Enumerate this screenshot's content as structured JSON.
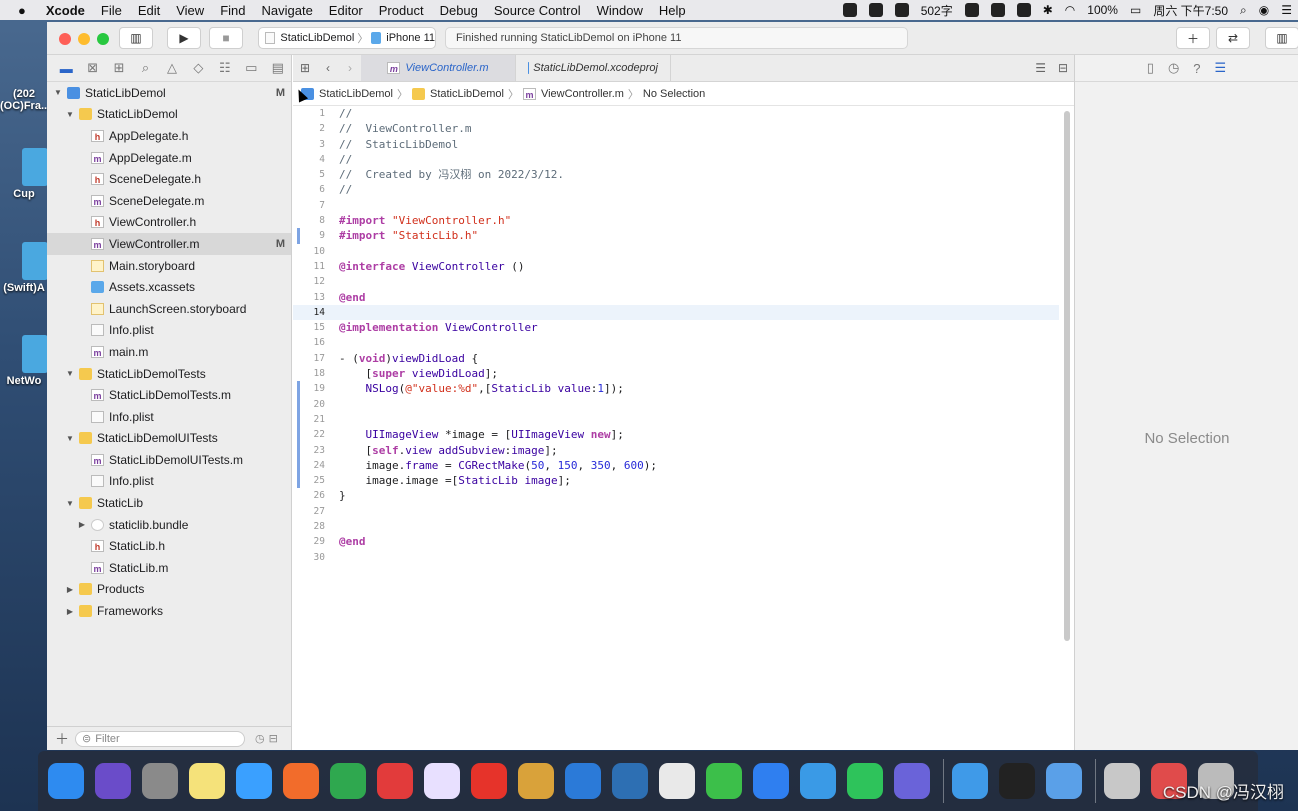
{
  "menubar": {
    "app": "Xcode",
    "items": [
      "File",
      "Edit",
      "View",
      "Find",
      "Navigate",
      "Editor",
      "Product",
      "Debug",
      "Source Control",
      "Window",
      "Help"
    ],
    "char_count": "502字",
    "battery": "100%",
    "clock": "周六 下午7:50"
  },
  "desktop": {
    "labels": [
      "(202",
      "(OC)Fra...",
      "Cup",
      "(Swift)A",
      "NetWo"
    ]
  },
  "toolbar": {
    "scheme": "StaticLibDemol",
    "device": "iPhone 11",
    "status": "Finished running StaticLibDemol on iPhone 11"
  },
  "navigator": {
    "filter_placeholder": "Filter",
    "items": [
      {
        "label": "StaticLibDemol",
        "type": "proj",
        "depth": 0,
        "expanded": true,
        "badge": "M"
      },
      {
        "label": "StaticLibDemol",
        "type": "folder",
        "depth": 1,
        "expanded": true,
        "badge": ""
      },
      {
        "label": "AppDelegate.h",
        "type": "h",
        "depth": 2,
        "badge": ""
      },
      {
        "label": "AppDelegate.m",
        "type": "m",
        "depth": 2,
        "badge": ""
      },
      {
        "label": "SceneDelegate.h",
        "type": "h",
        "depth": 2,
        "badge": ""
      },
      {
        "label": "SceneDelegate.m",
        "type": "m",
        "depth": 2,
        "badge": ""
      },
      {
        "label": "ViewController.h",
        "type": "h",
        "depth": 2,
        "badge": ""
      },
      {
        "label": "ViewController.m",
        "type": "m",
        "depth": 2,
        "badge": "M",
        "selected": true
      },
      {
        "label": "Main.storyboard",
        "type": "sb",
        "depth": 2,
        "badge": ""
      },
      {
        "label": "Assets.xcassets",
        "type": "xc",
        "depth": 2,
        "badge": ""
      },
      {
        "label": "LaunchScreen.storyboard",
        "type": "sb",
        "depth": 2,
        "badge": ""
      },
      {
        "label": "Info.plist",
        "type": "pl",
        "depth": 2,
        "badge": ""
      },
      {
        "label": "main.m",
        "type": "m",
        "depth": 2,
        "badge": ""
      },
      {
        "label": "StaticLibDemolTests",
        "type": "folder",
        "depth": 1,
        "expanded": true,
        "badge": ""
      },
      {
        "label": "StaticLibDemolTests.m",
        "type": "m",
        "depth": 2,
        "badge": ""
      },
      {
        "label": "Info.plist",
        "type": "pl",
        "depth": 2,
        "badge": ""
      },
      {
        "label": "StaticLibDemolUITests",
        "type": "folder",
        "depth": 1,
        "expanded": true,
        "badge": ""
      },
      {
        "label": "StaticLibDemolUITests.m",
        "type": "m",
        "depth": 2,
        "badge": ""
      },
      {
        "label": "Info.plist",
        "type": "pl",
        "depth": 2,
        "badge": ""
      },
      {
        "label": "StaticLib",
        "type": "folder",
        "depth": 1,
        "expanded": true,
        "badge": ""
      },
      {
        "label": "staticlib.bundle",
        "type": "bundle",
        "depth": 2,
        "collapsed": true,
        "badge": ""
      },
      {
        "label": "StaticLib.h",
        "type": "h",
        "depth": 2,
        "badge": ""
      },
      {
        "label": "StaticLib.m",
        "type": "m",
        "depth": 2,
        "badge": ""
      },
      {
        "label": "Products",
        "type": "folder",
        "depth": 1,
        "collapsed": true,
        "badge": ""
      },
      {
        "label": "Frameworks",
        "type": "folder",
        "depth": 1,
        "collapsed": true,
        "badge": ""
      }
    ]
  },
  "editor": {
    "tabs": [
      "ViewController.m",
      "StaticLibDemol.xcodeproj"
    ],
    "jumpbar": [
      "StaticLibDemol",
      "StaticLibDemol",
      "ViewController.m",
      "No Selection"
    ],
    "current_line": 14,
    "lines": [
      "//",
      "//  ViewController.m",
      "//  StaticLibDemol",
      "//",
      "//  Created by 冯汉栩 on 2022/3/12.",
      "//",
      "",
      "#import \"ViewController.h\"",
      "#import \"StaticLib.h\"",
      "",
      "@interface ViewController ()",
      "",
      "@end",
      "",
      "@implementation ViewController",
      "",
      "- (void)viewDidLoad {",
      "    [super viewDidLoad];",
      "    NSLog(@\"value:%d\",[StaticLib value:1]);",
      "",
      "",
      "    UIImageView *image = [UIImageView new];",
      "    [self.view addSubview:image];",
      "    image.frame = CGRectMake(50, 150, 350, 600);",
      "    image.image =[StaticLib image];",
      "}",
      "",
      "",
      "@end",
      ""
    ]
  },
  "inspector": {
    "empty_text": "No Selection"
  },
  "dock": {
    "apps": [
      "Finder",
      "Siri",
      "Launchpad",
      "Notes",
      "Baidu Netdisk",
      "Postman",
      "Evernote",
      "WPS",
      "Vivid",
      "NetEase Music",
      "Paint",
      "VS Code",
      "SourceTree",
      "Chrome",
      "WeChat",
      "Xcode",
      "Instruments",
      "FaceTime",
      "Keynote",
      "Simulator",
      "Terminal",
      "QuickTime",
      "Screen",
      "Photos",
      "Trash"
    ]
  },
  "watermark": "CSDN @冯汉栩",
  "colors": {
    "keyword": "#ad3da4",
    "string": "#d12f1b",
    "comment": "#5d6c79",
    "number": "#272ad8",
    "type": "#3900a0",
    "selection": "#2a65c9"
  }
}
